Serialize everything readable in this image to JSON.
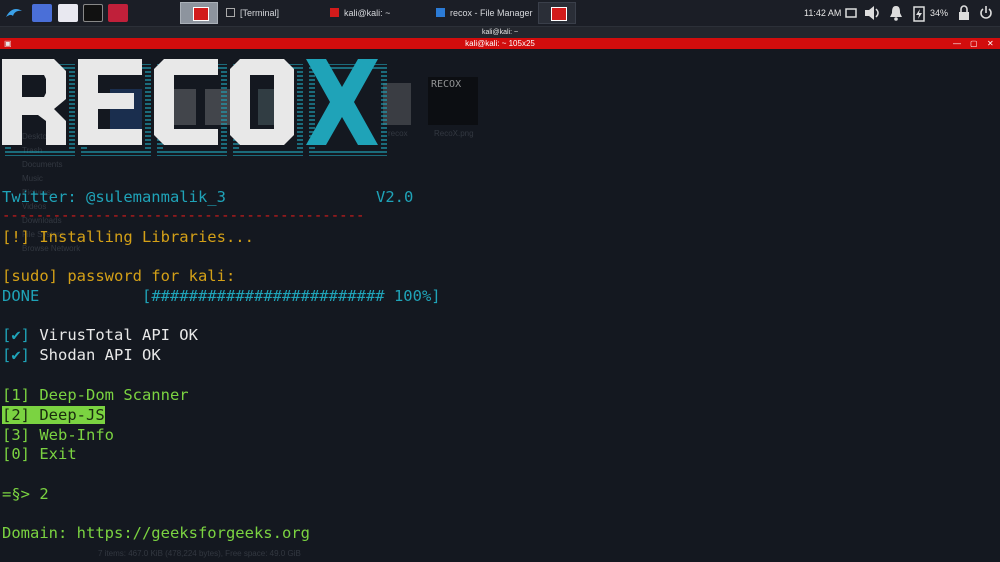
{
  "panel": {
    "tasks": [
      {
        "label": "[Terminal]",
        "color": "#3a3f4a"
      },
      {
        "label": "kali@kali: ~",
        "color": "#d21b1b"
      },
      {
        "label": "recox - File Manager",
        "color": "#2b7bd6"
      }
    ],
    "clock": "11:42 AM",
    "battery": "34%"
  },
  "window": {
    "wm_title": "kali@kali: ~",
    "terminal_title": "kali@kali: ~ 105x25"
  },
  "background_fm": {
    "files": [
      "recox",
      "RecoX.png"
    ],
    "thumb_text": "RECOX",
    "sidebar": [
      "Desktop",
      "Trash",
      "Documents",
      "Music",
      "Pictures",
      "Videos",
      "Downloads",
      "File System",
      "Browse Network"
    ],
    "status": "7 items: 467.0 KiB (478,224 bytes), Free space: 49.0 GiB"
  },
  "terminal": {
    "banner": "RECOX",
    "twitter_label": "Twitter: @sulemanmalik_3",
    "version": "V2.0",
    "separator": "-------------------------------------------",
    "installing": "[!] Installing Libraries...",
    "sudo_prompt": "[sudo] password for kali:",
    "done_label": "DONE",
    "progress": "[######################### 100%]",
    "check_mark": "[✔]",
    "vt_ok": " VirusTotal API OK",
    "shodan_ok": " Shodan API OK",
    "menu": [
      "[1] Deep-Dom Scanner",
      "[2] Deep-JS",
      "[3] Web-Info",
      "[0] Exit"
    ],
    "prompt": "=§> 2",
    "domain": "Domain: https://geeksforgeeks.org"
  },
  "colors": {
    "cyan": "#1fa3b8",
    "yellow": "#d4a017",
    "green": "#7bd341",
    "red": "#d21b1b",
    "terminal_bg": "#141820"
  }
}
